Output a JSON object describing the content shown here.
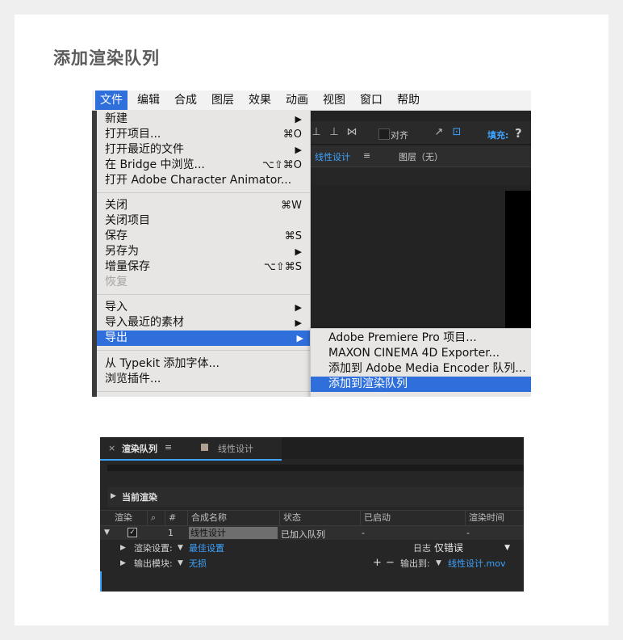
{
  "heading": "添加渲染队列",
  "menubar": {
    "items": [
      "文件",
      "编辑",
      "合成",
      "图层",
      "效果",
      "动画",
      "视图",
      "窗口",
      "帮助"
    ]
  },
  "file_menu": {
    "items": [
      {
        "label": "新建",
        "shortcut": "",
        "submenu": true
      },
      {
        "label": "打开项目...",
        "shortcut": "⌘O",
        "submenu": false
      },
      {
        "label": "打开最近的文件",
        "shortcut": "",
        "submenu": true
      },
      {
        "label": "在 Bridge 中浏览...",
        "shortcut": "⌥⇧⌘O",
        "submenu": false
      },
      {
        "label": "打开 Adobe Character Animator...",
        "shortcut": "",
        "submenu": false
      },
      {
        "label": "关闭",
        "shortcut": "⌘W",
        "submenu": false
      },
      {
        "label": "关闭项目",
        "shortcut": "",
        "submenu": false
      },
      {
        "label": "保存",
        "shortcut": "⌘S",
        "submenu": false
      },
      {
        "label": "另存为",
        "shortcut": "",
        "submenu": true
      },
      {
        "label": "增量保存",
        "shortcut": "⌥⇧⌘S",
        "submenu": false
      },
      {
        "label": "恢复",
        "shortcut": "",
        "submenu": false
      },
      {
        "label": "导入",
        "shortcut": "",
        "submenu": true
      },
      {
        "label": "导入最近的素材",
        "shortcut": "",
        "submenu": true
      },
      {
        "label": "导出",
        "shortcut": "",
        "submenu": true
      },
      {
        "label": "从 Typekit 添加字体...",
        "shortcut": "",
        "submenu": false
      },
      {
        "label": "浏览插件...",
        "shortcut": "",
        "submenu": false
      }
    ]
  },
  "export_submenu": {
    "items": [
      "Adobe Premiere Pro 项目...",
      "MAXON CINEMA 4D Exporter...",
      "添加到 Adobe Media Encoder 队列...",
      "添加到渲染队列"
    ]
  },
  "toolbar": {
    "align_label": "对齐",
    "fill_label": "填充:",
    "help_icon": "?"
  },
  "comp_tabs": {
    "comp_name": "线性设计",
    "layer_label": "图层（无）"
  },
  "render_queue": {
    "tab_label": "渲染队列",
    "comp_tab": "线性设计",
    "current_render": "当前渲染",
    "columns": [
      "渲染",
      "#",
      "合成名称",
      "状态",
      "已启动",
      "渲染时间"
    ],
    "row": {
      "index": "1",
      "comp_name": "线性设计",
      "status": "已加入队列",
      "started": "-",
      "render_time": "-"
    },
    "render_settings_label": "渲染设置:",
    "render_settings_value": "最佳设置",
    "log_label": "日志:",
    "log_value": "仅错误",
    "output_module_label": "输出模块:",
    "output_module_value": "无损",
    "output_to_label": "输出到:",
    "output_to_value": "线性设计.mov"
  }
}
